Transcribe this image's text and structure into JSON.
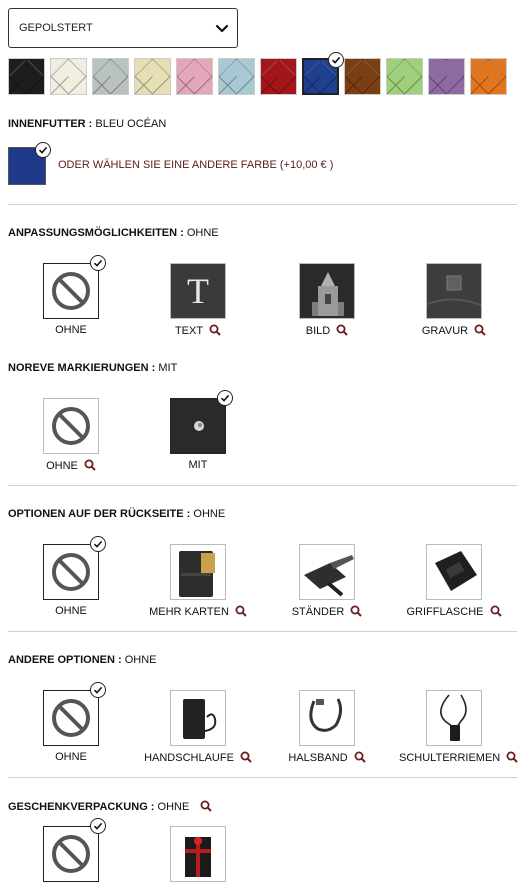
{
  "finish_select": {
    "value": "GEPOLSTERT"
  },
  "swatch_colors": [
    "#1d1d1d",
    "#f1ede0",
    "#b9c2bf",
    "#e6dfb5",
    "#e4a7b9",
    "#a7c9d3",
    "#a4151a",
    "#1f3f8f",
    "#7a3e12",
    "#9fd07a",
    "#8d6aa4",
    "#e2761f"
  ],
  "lining": {
    "label": "INNENFUTTER : ",
    "value": "BLEU OCÉAN",
    "color": "#1f3a8a",
    "other_link": "ODER WÄHLEN SIE EINE ANDERE FARBE (+10,00 € )"
  },
  "sections": {
    "custom": {
      "label": "ANPASSUNGSMÖGLICHKEITEN : ",
      "value": "OHNE",
      "options": [
        "OHNE",
        "TEXT",
        "BILD",
        "GRAVUR"
      ]
    },
    "marks": {
      "label": "NOREVE MARKIERUNGEN : ",
      "value": "MIT",
      "options": [
        "OHNE",
        "MIT"
      ]
    },
    "back": {
      "label": "OPTIONEN AUF DER RÜCKSEITE : ",
      "value": "OHNE",
      "options": [
        "OHNE",
        "MEHR KARTEN",
        "STÄNDER",
        "GRIFFLASCHE"
      ]
    },
    "other": {
      "label": "ANDERE OPTIONEN : ",
      "value": "OHNE",
      "options": [
        "OHNE",
        "HANDSCHLAUFE",
        "HALSBAND",
        "SCHULTERRIEMEN"
      ]
    },
    "gift": {
      "label": "GESCHENKVERPACKUNG : ",
      "value": "OHNE"
    }
  },
  "text_thumb_glyph": "T",
  "accent_color": "#6b1f1f"
}
